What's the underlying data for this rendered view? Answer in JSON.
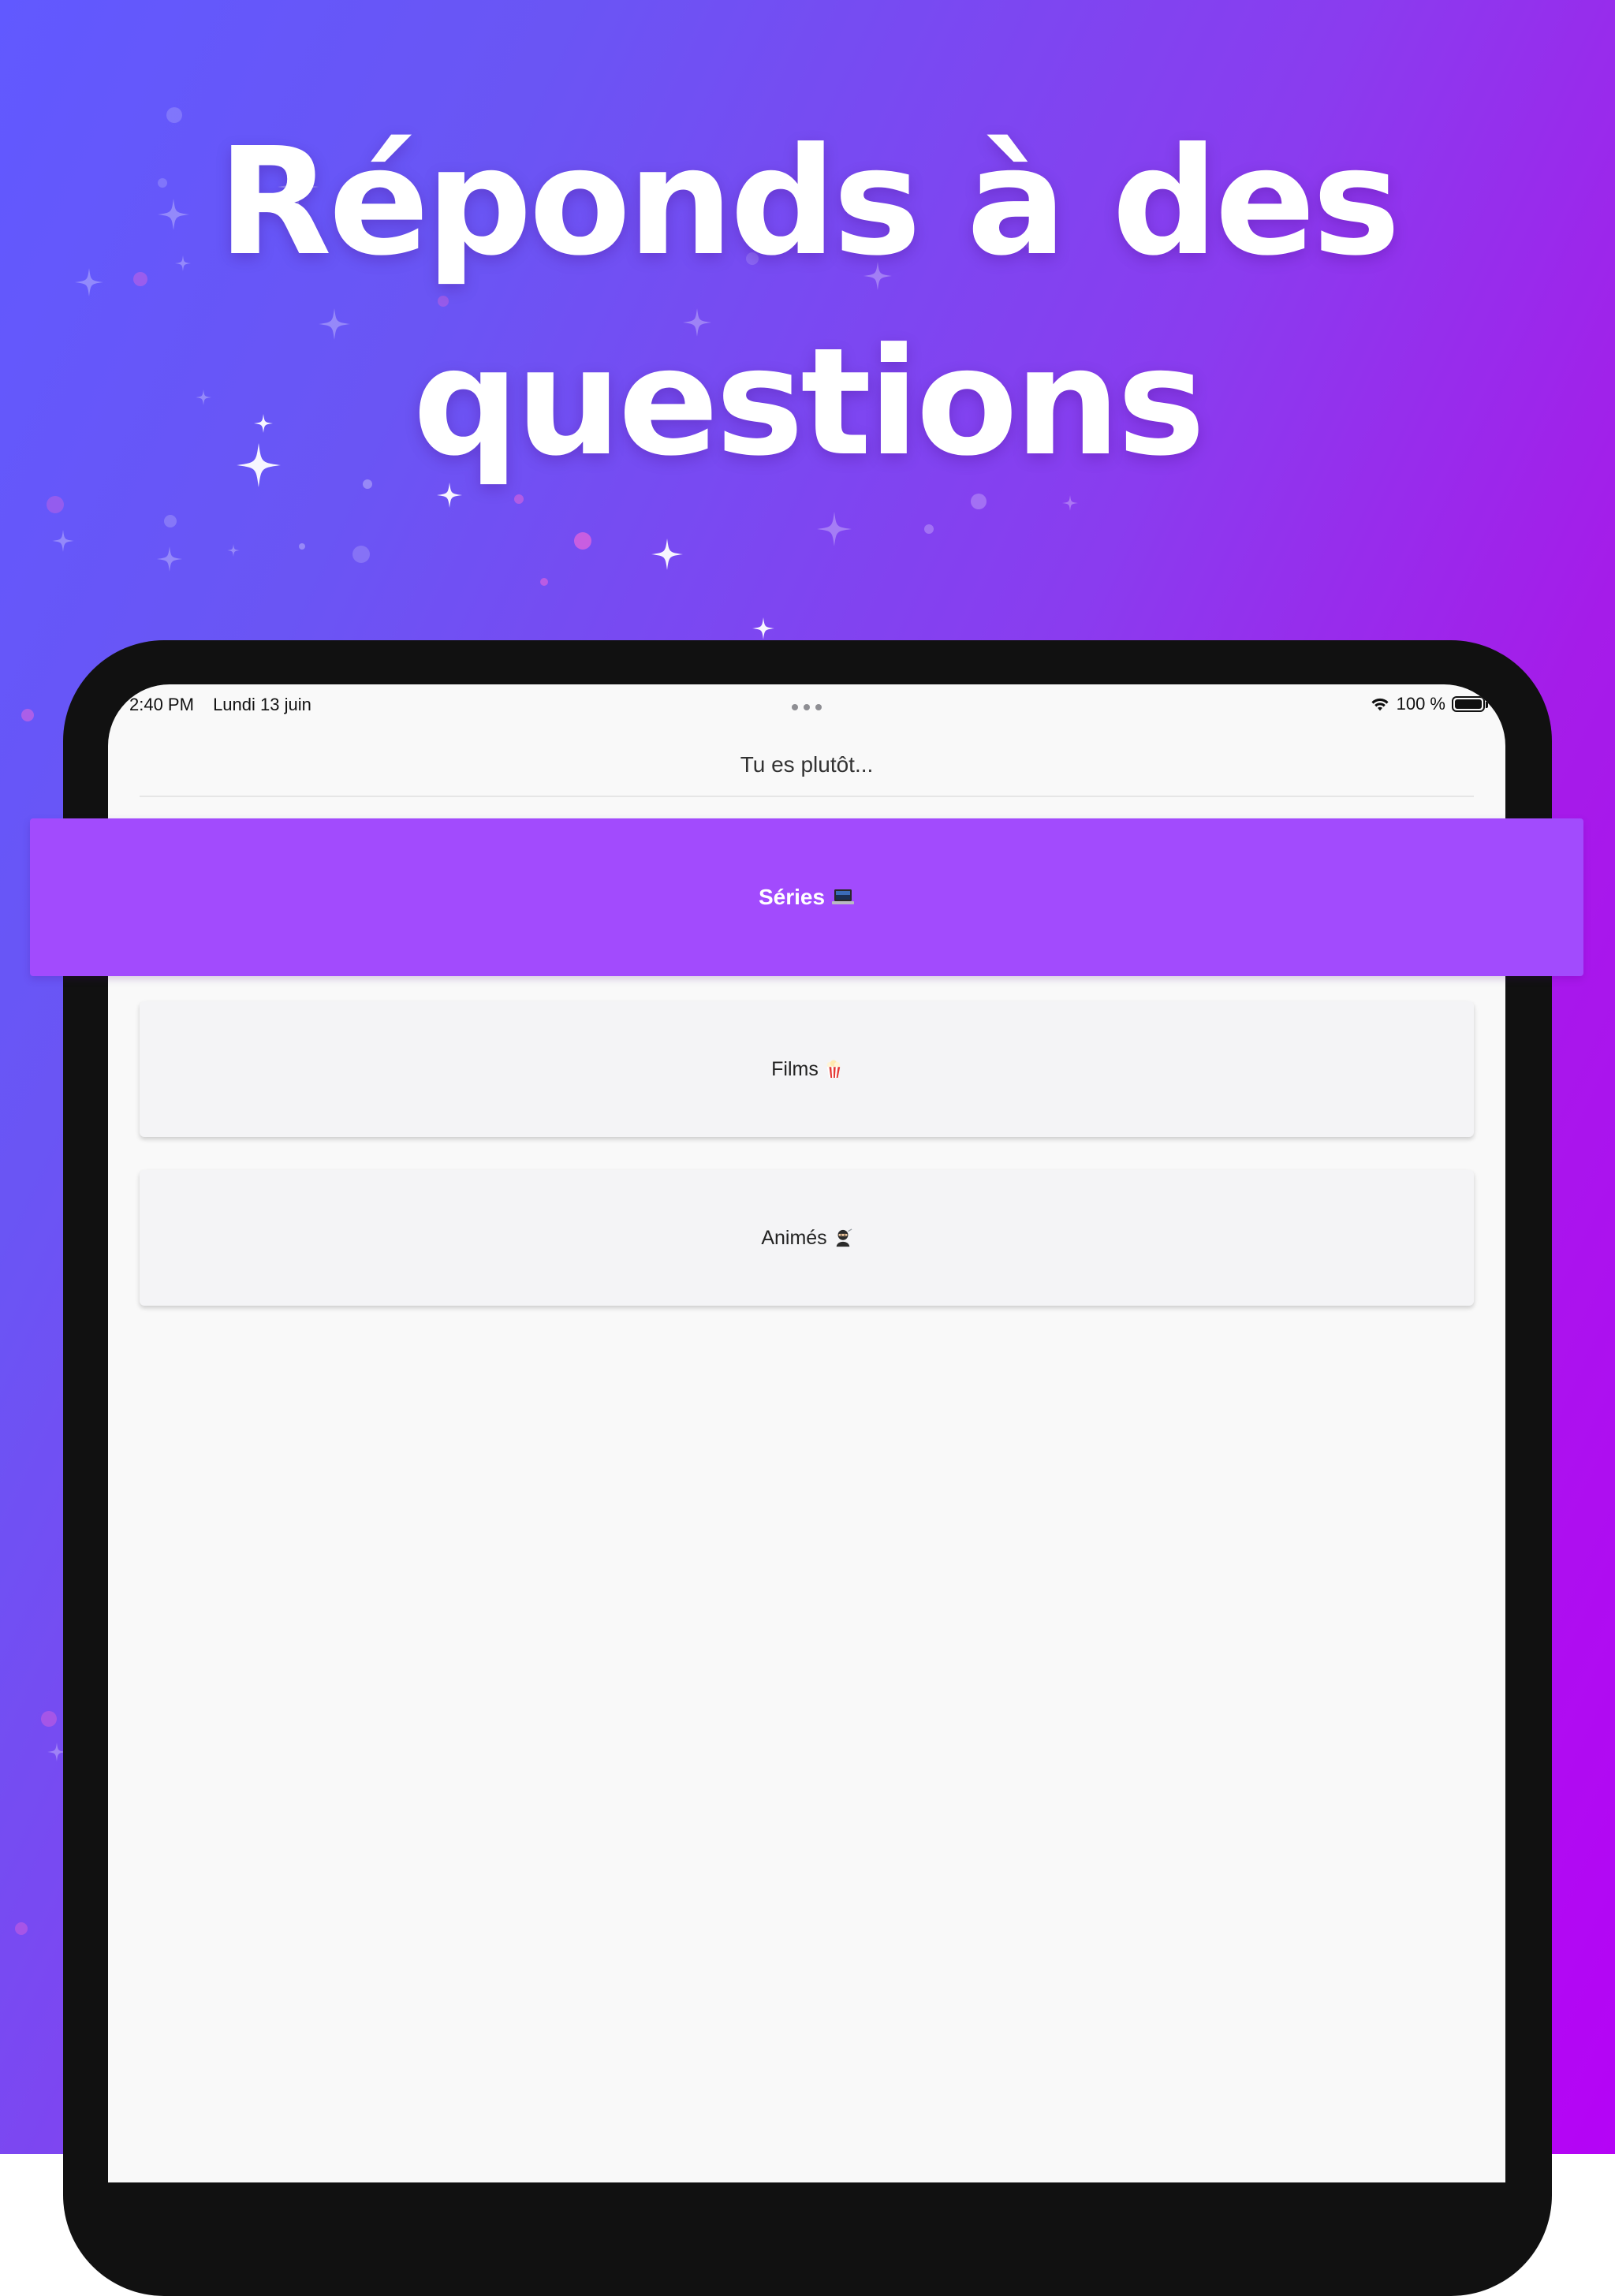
{
  "headline": {
    "line1": "Réponds à des",
    "line2": "questions"
  },
  "status_bar": {
    "time": "2:40 PM",
    "date": "Lundi 13 juin",
    "battery": "100 %"
  },
  "nav": {
    "title": "Tu es plutôt..."
  },
  "options": [
    {
      "label": "Séries",
      "icon": "laptop-icon",
      "selected": true
    },
    {
      "label": "Films",
      "icon": "popcorn-icon",
      "selected": false
    },
    {
      "label": "Animés",
      "icon": "ninja-icon",
      "selected": false
    }
  ],
  "colors": {
    "gradient_start": "#6159ff",
    "gradient_end": "#b503f6",
    "selected_option": "#a24bfd",
    "option_background": "#f4f4f6",
    "screen_background": "#f9f9f9"
  }
}
